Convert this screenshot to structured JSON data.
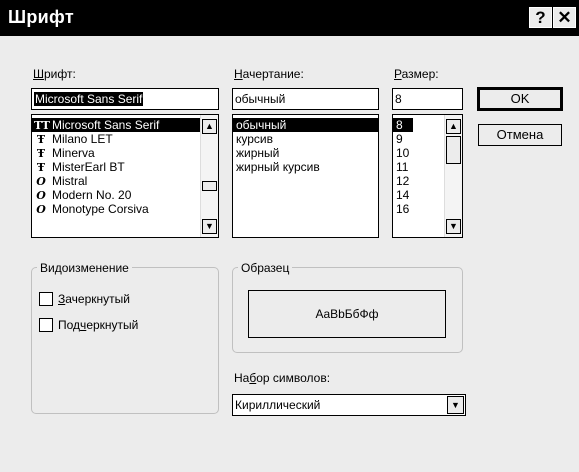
{
  "window": {
    "title": "Шрифт",
    "help_icon": "?",
    "close_icon": "✕"
  },
  "font": {
    "label_key": "Ш",
    "label_rest": "рифт:",
    "value": "Microsoft Sans Serif",
    "items": [
      {
        "icon": "TT",
        "label": "Microsoft Sans Serif"
      },
      {
        "icon": "Ŧ",
        "label": "Milano LET"
      },
      {
        "icon": "Ŧ",
        "label": "Minerva"
      },
      {
        "icon": "Ŧ",
        "label": "MisterEarl BT"
      },
      {
        "icon": "O",
        "label": "Mistral"
      },
      {
        "icon": "O",
        "label": "Modern No. 20"
      },
      {
        "icon": "O",
        "label": "Monotype Corsiva"
      }
    ]
  },
  "style": {
    "label_key": "Н",
    "label_rest": "ачертание:",
    "value": "обычный",
    "items": [
      "обычный",
      "курсив",
      "жирный",
      "жирный курсив"
    ]
  },
  "size": {
    "label_key": "Р",
    "label_rest": "азмер:",
    "value": "8",
    "items": [
      "8",
      "9",
      "10",
      "11",
      "12",
      "14",
      "16"
    ]
  },
  "buttons": {
    "ok": "OK",
    "cancel": "Отмена"
  },
  "effects": {
    "title": "Видоизменение",
    "strike_key": "З",
    "strike_rest": "ачеркнутый",
    "underline_pre": "Под",
    "underline_key": "ч",
    "underline_rest": "еркнутый"
  },
  "sample": {
    "title": "Образец",
    "text": "AaBbБбФф"
  },
  "charset": {
    "label_pre": "На",
    "label_key": "б",
    "label_rest": "ор символов:",
    "value": "Кириллический"
  },
  "icons": {
    "up": "▲",
    "down": "▼"
  }
}
